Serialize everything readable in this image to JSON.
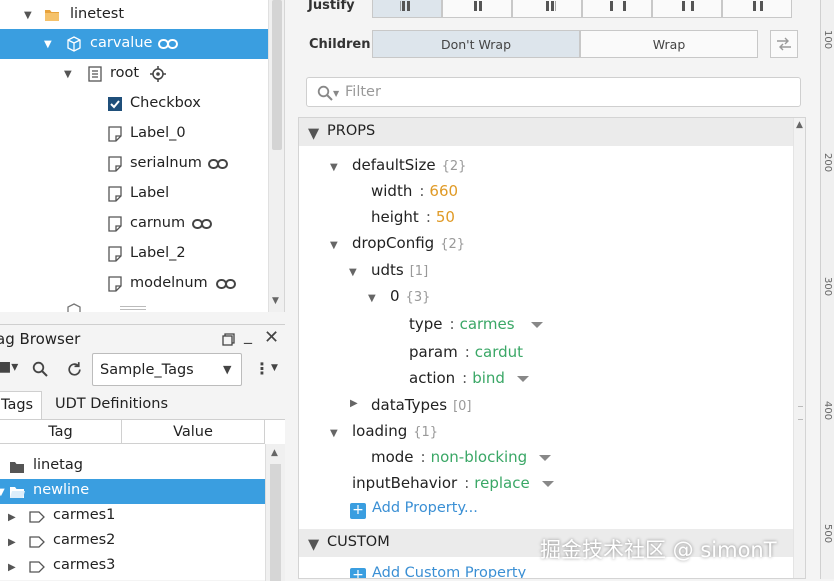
{
  "project_tree": {
    "items": [
      {
        "label": "linetest",
        "icon": "folder-open-icon"
      },
      {
        "label": "carvalue",
        "icon": "component-icon",
        "linked": true
      },
      {
        "label": "root",
        "icon": "container-icon",
        "target": true
      },
      {
        "label": "Checkbox",
        "icon": "checkbox-icon"
      },
      {
        "label": "Label_0",
        "icon": "label-icon"
      },
      {
        "label": "serialnum",
        "icon": "label-icon",
        "linked": true
      },
      {
        "label": "Label",
        "icon": "label-icon"
      },
      {
        "label": "carnum",
        "icon": "label-icon",
        "linked": true
      },
      {
        "label": "Label_2",
        "icon": "label-icon"
      },
      {
        "label": "modelnum",
        "icon": "label-icon",
        "linked": true
      }
    ]
  },
  "tag_browser": {
    "title": "ag Browser",
    "provider": "Sample_Tags",
    "tabs": [
      "Tags",
      "UDT Definitions"
    ],
    "columns": [
      "Tag",
      "Value"
    ],
    "rows": [
      {
        "label": "linetag",
        "icon": "folder-icon"
      },
      {
        "label": "newline",
        "icon": "folder-open-icon"
      },
      {
        "label": "carmes1",
        "icon": "udt-instance-icon"
      },
      {
        "label": "carmes2",
        "icon": "udt-instance-icon"
      },
      {
        "label": "carmes3",
        "icon": "udt-instance-icon"
      }
    ]
  },
  "position": {
    "justify_label": "Justify",
    "children_label": "Children",
    "children_options": [
      "Don't Wrap",
      "Wrap"
    ]
  },
  "filter": {
    "placeholder": "Filter"
  },
  "props": {
    "section": "PROPS",
    "defaultSize": {
      "key": "defaultSize",
      "count": "{2}"
    },
    "width": {
      "key": "width",
      "value": "660"
    },
    "height": {
      "key": "height",
      "value": "50"
    },
    "dropConfig": {
      "key": "dropConfig",
      "count": "{2}"
    },
    "udts": {
      "key": "udts",
      "count": "[1]"
    },
    "zero": {
      "key": "0",
      "count": "{3}"
    },
    "type": {
      "key": "type",
      "value": "carmes"
    },
    "param": {
      "key": "param",
      "value": "cardut"
    },
    "action": {
      "key": "action",
      "value": "bind"
    },
    "dataTypes": {
      "key": "dataTypes",
      "count": "[0]"
    },
    "loading": {
      "key": "loading",
      "count": "{1}"
    },
    "mode": {
      "key": "mode",
      "value": "non-blocking"
    },
    "inputBehavior": {
      "key": "inputBehavior",
      "value": "replace"
    },
    "add_property": "Add Property..."
  },
  "custom": {
    "section": "CUSTOM",
    "add_property": "Add Custom Property"
  },
  "ruler": {
    "ticks": [
      "100",
      "200",
      "300",
      "400",
      "500"
    ]
  },
  "watermark": "掘金技术社区 @ simonT"
}
